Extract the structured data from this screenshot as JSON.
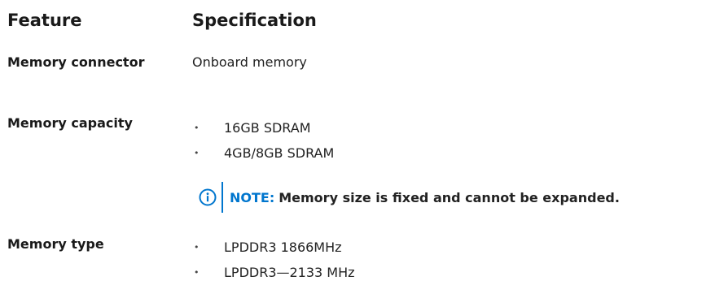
{
  "header": {
    "feature": "Feature",
    "specification": "Specification"
  },
  "rows": [
    {
      "feature": "Memory connector",
      "spec": "Onboard memory"
    },
    {
      "feature": "Memory capacity",
      "items": [
        "16GB SDRAM",
        "4GB/8GB SDRAM"
      ],
      "note": {
        "label": "NOTE:",
        "text": "Memory size is fixed and cannot be expanded.",
        "icon": "info-icon"
      }
    },
    {
      "feature": "Memory type",
      "items": [
        "LPDDR3 1866MHz",
        "LPDDR3—2133 MHz"
      ]
    }
  ],
  "colors": {
    "note_accent": "#0076ce",
    "text": "#222222"
  }
}
